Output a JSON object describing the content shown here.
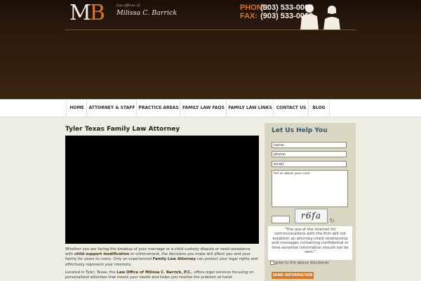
{
  "header": {
    "logo_mark_m": "M",
    "logo_mark_b": "B",
    "logo_small": "law offices of",
    "logo_name": "Milissa C. Barrick",
    "phone_label": "PHONE:",
    "phone_number": "(903) 533-0008",
    "fax_label": "FAX:",
    "fax_number": "(903) 533-0003"
  },
  "nav": {
    "items": [
      "HOME",
      "ATTORNEY & STAFF",
      "PRACTICE AREAS",
      "FAMILY LAW FAQS",
      "FAMILY LAW LINKS",
      "CONTACT US",
      "BLOG"
    ]
  },
  "main": {
    "title": "Tyler Texas Family Law Attorney",
    "p1_a": "Whether you are facing the breakup of your marriage or a child custody dispute or need assistance with ",
    "p1_b": "child support modification",
    "p1_c": " or enforcement, the decisions you make will affect you and your family for years to come. Only an experienced ",
    "p1_d": "Family Law Attorney",
    "p1_e": " can protect your legal rights and effectively represent your interests.",
    "p2_a": "Located in Tyler, Texas, the ",
    "p2_b": "Law Office of Milissa C. Barrick, P.C.",
    "p2_c": ", offers legal services focusing on personalized attention that meets your needs and helps you resolve the problem at hand."
  },
  "sidebar": {
    "title": "Let Us Help You",
    "name_value": "name:",
    "phone_value": "phone:",
    "email_value": "email:",
    "case_value": "tell us about your case:",
    "captcha_text": "r6fa",
    "disclaimer": "\"The use of the Internet for communications with the firm will not establish an attorney-client relationship and messages containing confidential or time-sensitive information should not be sent.\"",
    "agree_label": "gree to the above disclaimer",
    "submit_label": "SEND INFORMATION"
  },
  "colors": {
    "accent": "#e07820",
    "header_bg": "#2a1a0c",
    "sidebar_title": "#2e5a78"
  }
}
